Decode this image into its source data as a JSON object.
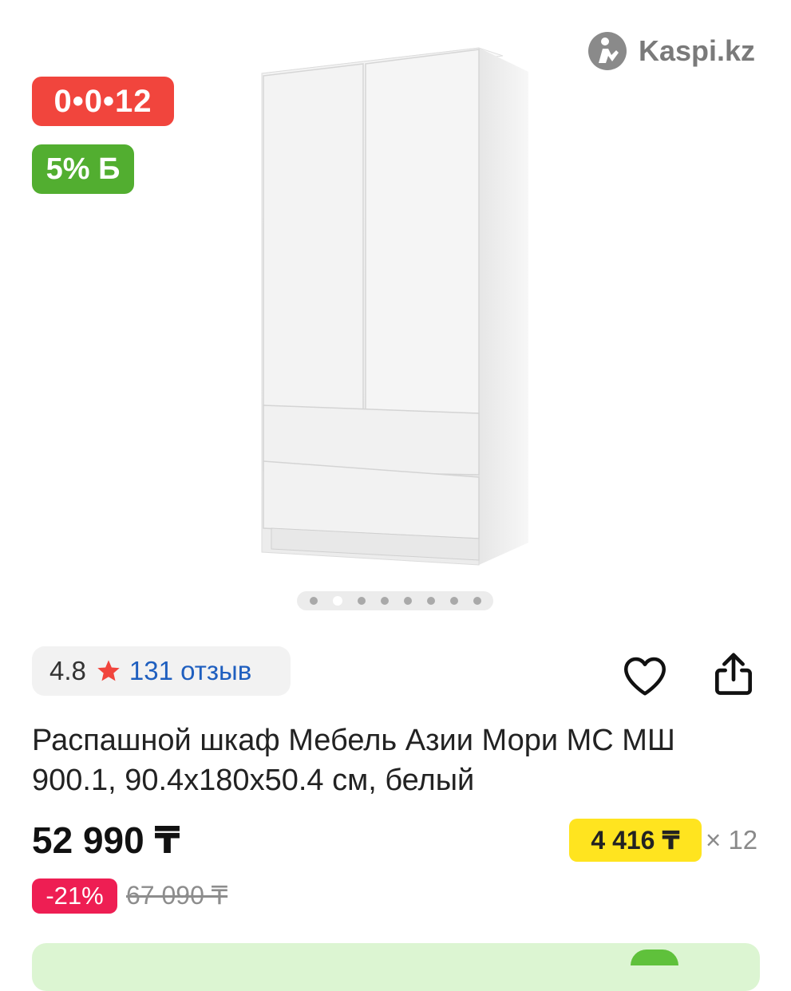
{
  "badges": {
    "installment": "0•0•12",
    "bonus": "5% Б"
  },
  "logo": {
    "text": "Kaspi.kz",
    "icon": "kaspi-logo-icon"
  },
  "carousel": {
    "total_dots": 8,
    "active_index": 1
  },
  "rating": {
    "value": "4.8",
    "reviews_label": "131 отзыв",
    "star_color": "#f1453d"
  },
  "actions": {
    "favorite_icon": "heart-icon",
    "share_icon": "share-icon"
  },
  "product": {
    "title": "Распашной шкаф Мебель Азии Мори МС МШ 900.1, 90.4x180x50.4 см, белый"
  },
  "price": {
    "current": "52 990 ₸",
    "monthly": "4 416 ₸",
    "multiplier": "× 12",
    "discount": "-21%",
    "old": "67 090 ₸"
  },
  "colors": {
    "installment_badge": "#f1453d",
    "bonus_badge": "#52ae30",
    "monthly_badge": "#ffe41f",
    "discount_badge": "#ee1e53",
    "link": "#1f5fbf"
  }
}
